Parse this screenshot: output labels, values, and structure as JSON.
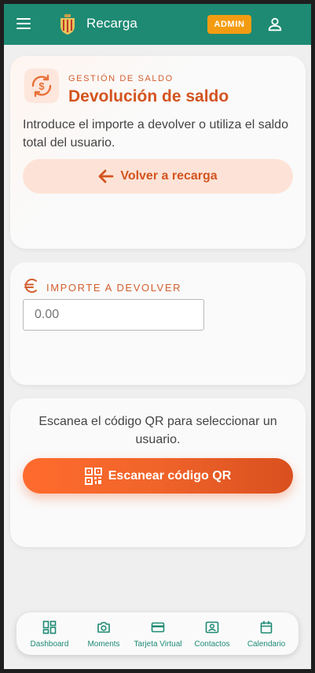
{
  "header": {
    "title": "Recarga",
    "badge": "ADMIN",
    "color": "#1e8a73"
  },
  "balance_card": {
    "section_label": "GESTIÓN DE SALDO",
    "title": "Devolución de saldo",
    "intro": "Introduce el importe a devolver o utiliza el saldo total del usuario.",
    "back_button": "Volver a recarga",
    "icon": "refund-cycle-icon"
  },
  "amount_card": {
    "label": "IMPORTE A DEVOLVER",
    "input_placeholder": "0.00",
    "icon": "euro-icon"
  },
  "qr_card": {
    "text": "Escanea el código QR para seleccionar un usuario.",
    "scan_button": "Escanear código QR",
    "icon": "qr-code-icon"
  },
  "bottom_nav": {
    "items": [
      {
        "label": "Dashboard",
        "icon": "dashboard-icon"
      },
      {
        "label": "Moments",
        "icon": "camera-icon"
      },
      {
        "label": "Tarjeta Virtual",
        "icon": "credit-card-icon"
      },
      {
        "label": "Contactos",
        "icon": "contact-card-icon"
      },
      {
        "label": "Calendario",
        "icon": "calendar-icon"
      }
    ]
  },
  "colors": {
    "accent": "#d3541f",
    "primary": "#1e8a73",
    "badge": "#f39c12"
  }
}
